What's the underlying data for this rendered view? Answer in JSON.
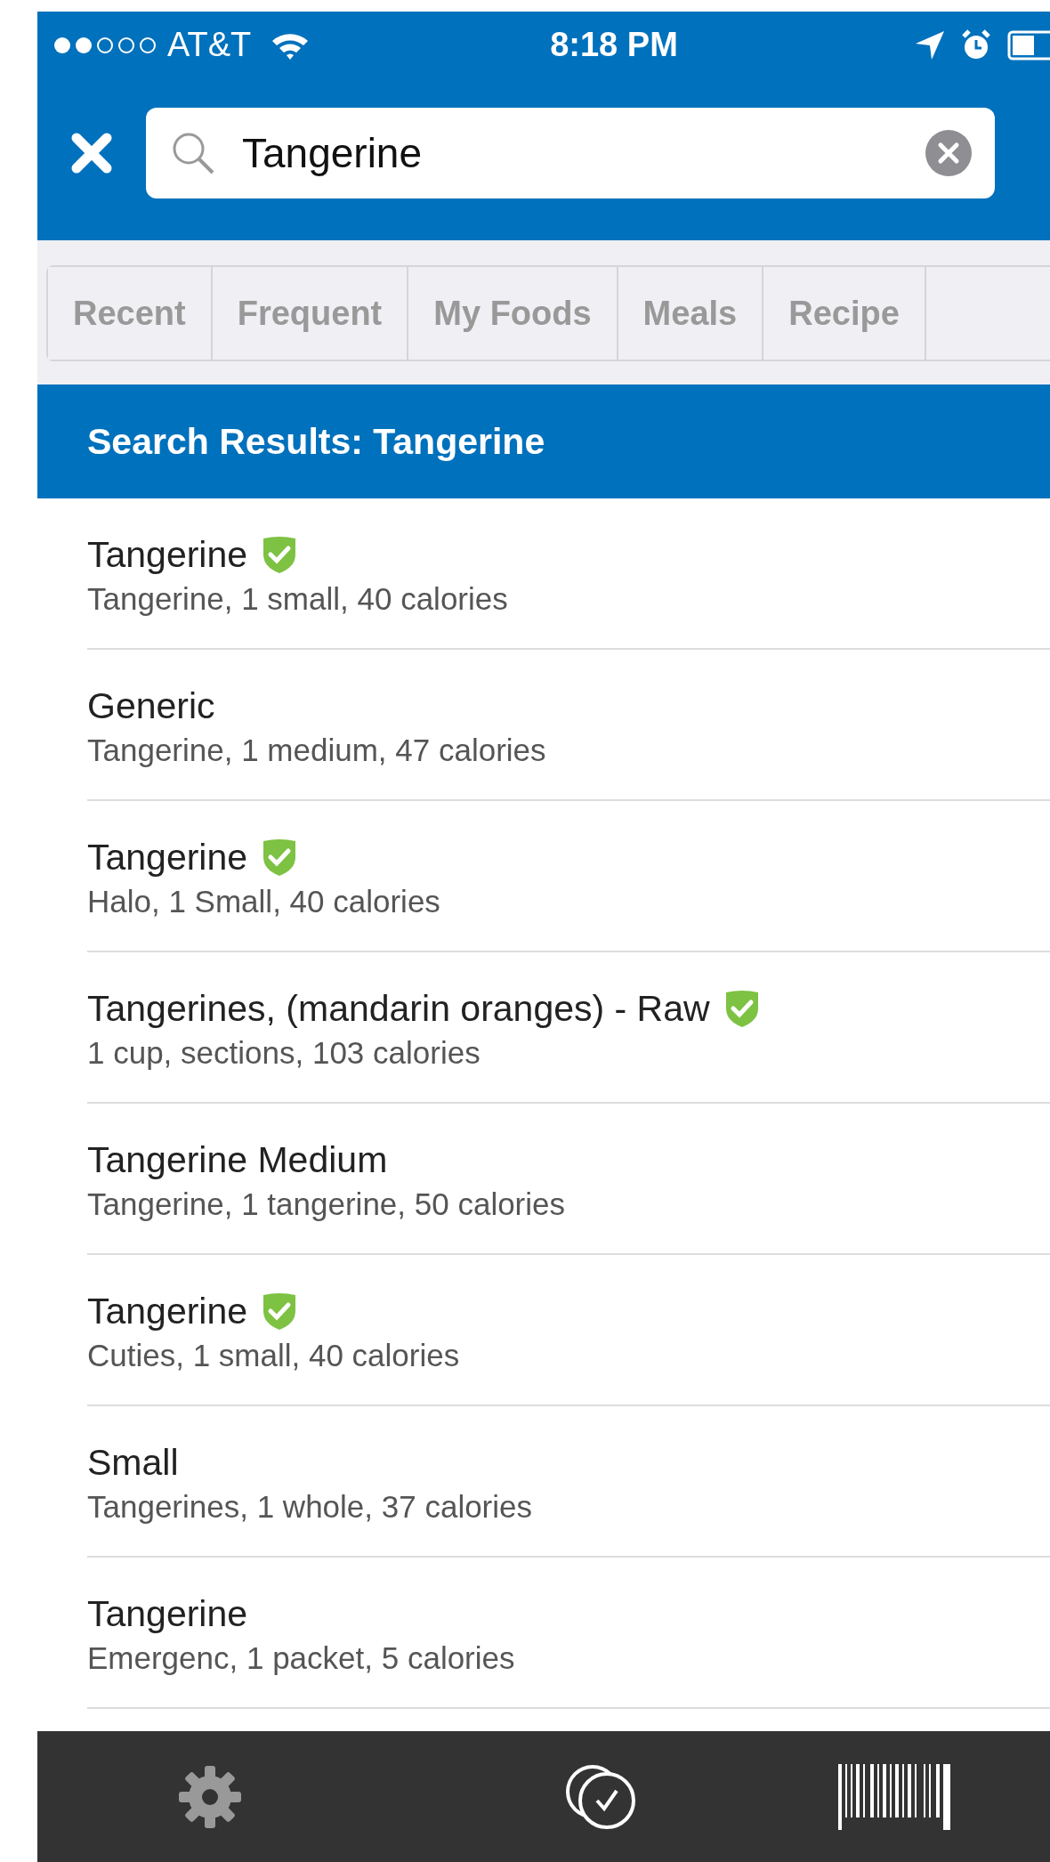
{
  "status_bar": {
    "carrier": "AT&T",
    "time": "8:18 PM"
  },
  "search": {
    "value": "Tangerine"
  },
  "tabs": [
    {
      "label": "Recent",
      "selected": false
    },
    {
      "label": "Frequent",
      "selected": false
    },
    {
      "label": "My Foods",
      "selected": false
    },
    {
      "label": "Meals",
      "selected": false
    },
    {
      "label": "Recipe",
      "selected": false
    }
  ],
  "results_header": "Search Results: Tangerine",
  "results": [
    {
      "title": "Tangerine",
      "verified": true,
      "detail": "Tangerine, 1 small, 40 calories"
    },
    {
      "title": "Generic",
      "verified": false,
      "detail": "Tangerine, 1 medium, 47 calories"
    },
    {
      "title": "Tangerine",
      "verified": true,
      "detail": "Halo, 1 Small, 40 calories"
    },
    {
      "title": "Tangerines, (mandarin oranges) - Raw",
      "verified": true,
      "detail": "1 cup, sections, 103 calories"
    },
    {
      "title": "Tangerine Medium",
      "verified": false,
      "detail": "Tangerine, 1 tangerine, 50 calories"
    },
    {
      "title": "Tangerine",
      "verified": true,
      "detail": "Cuties, 1 small, 40 calories"
    },
    {
      "title": "Small",
      "verified": false,
      "detail": "Tangerines, 1 whole, 37 calories"
    },
    {
      "title": "Tangerine",
      "verified": false,
      "detail": "Emergenc, 1 packet, 5 calories"
    }
  ]
}
